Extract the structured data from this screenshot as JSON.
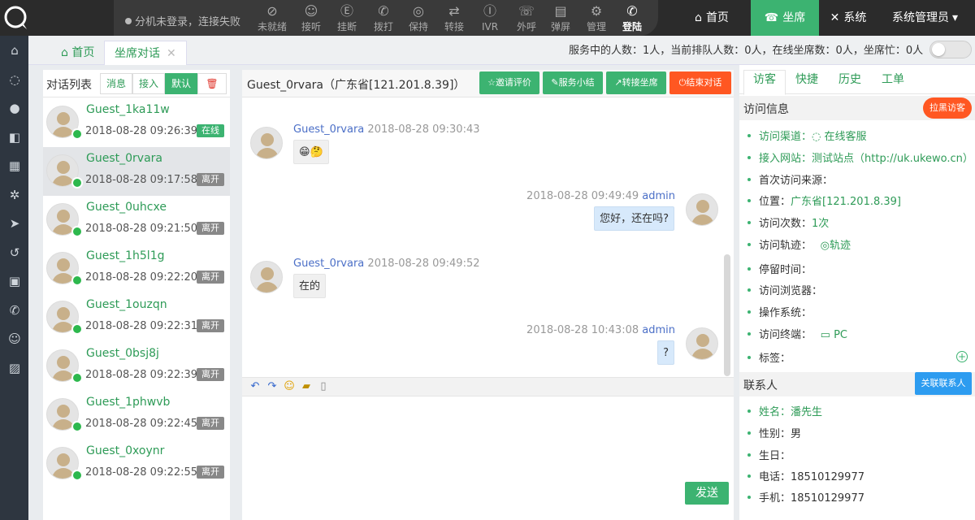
{
  "header": {
    "status_text": "分机未登录，连接失败",
    "tools": [
      {
        "label": "未就绪",
        "icon": "not-ready-icon",
        "glyph": "⊘"
      },
      {
        "label": "接听",
        "icon": "answer-icon",
        "glyph": "☺"
      },
      {
        "label": "挂断",
        "icon": "hangup-icon",
        "glyph": "Ⓔ"
      },
      {
        "label": "拨打",
        "icon": "dial-icon",
        "glyph": "✆"
      },
      {
        "label": "保持",
        "icon": "hold-icon",
        "glyph": "◎"
      },
      {
        "label": "转接",
        "icon": "transfer-icon",
        "glyph": "⇄"
      },
      {
        "label": "IVR",
        "icon": "ivr-icon",
        "glyph": "Ⓘ"
      },
      {
        "label": "外呼",
        "icon": "outbound-icon",
        "glyph": "☏"
      },
      {
        "label": "弹屏",
        "icon": "popup-icon",
        "glyph": "▤"
      },
      {
        "label": "管理",
        "icon": "manage-icon",
        "glyph": "⚙"
      },
      {
        "label": "登陆",
        "icon": "login-icon",
        "glyph": "✆"
      }
    ],
    "nav": [
      {
        "label": "首页",
        "icon": "home-icon",
        "glyph": "⌂"
      },
      {
        "label": "坐席",
        "icon": "seat-icon",
        "glyph": "☎"
      },
      {
        "label": "系统",
        "icon": "tools-icon",
        "glyph": "✕"
      },
      {
        "label": "系统管理员",
        "icon": "user-icon",
        "glyph": "▾"
      }
    ]
  },
  "sidebar": {
    "icons": [
      {
        "name": "home-icon",
        "glyph": "⌂"
      },
      {
        "name": "chat-icon",
        "glyph": "◌"
      },
      {
        "name": "user-icon",
        "glyph": "●"
      },
      {
        "name": "contact-icon",
        "glyph": "◧"
      },
      {
        "name": "apps-icon",
        "glyph": "▦"
      },
      {
        "name": "gear-icon",
        "glyph": "✲"
      },
      {
        "name": "send-icon",
        "glyph": "➤"
      },
      {
        "name": "history-icon",
        "glyph": "↺"
      },
      {
        "name": "document-icon",
        "glyph": "▣"
      },
      {
        "name": "phone-icon",
        "glyph": "✆"
      },
      {
        "name": "service-icon",
        "glyph": "☺"
      },
      {
        "name": "report-icon",
        "glyph": "▨"
      }
    ]
  },
  "crumbs": {
    "home": "首页",
    "current": "坐席对话",
    "close": "✕"
  },
  "stats": "服务中的人数：1人，当前排队人数：0人，在线坐席数：0人，坐席忙：0人",
  "conv_list": {
    "title": "对话列表",
    "buttons": [
      "消息",
      "接入",
      "默认",
      "🗑"
    ],
    "items": [
      {
        "name": "Guest_1ka11w",
        "time": "2018-08-28 09:26:39",
        "status": "在线",
        "online": true
      },
      {
        "name": "Guest_0rvara",
        "time": "2018-08-28 09:17:58",
        "status": "离开",
        "online": false
      },
      {
        "name": "Guest_0uhcxe",
        "time": "2018-08-28 09:21:50",
        "status": "离开",
        "online": false
      },
      {
        "name": "Guest_1h5l1g",
        "time": "2018-08-28 09:22:20",
        "status": "离开",
        "online": false
      },
      {
        "name": "Guest_1ouzqn",
        "time": "2018-08-28 09:22:31",
        "status": "离开",
        "online": false
      },
      {
        "name": "Guest_0bsj8j",
        "time": "2018-08-28 09:22:39",
        "status": "离开",
        "online": false
      },
      {
        "name": "Guest_1phwvb",
        "time": "2018-08-28 09:22:45",
        "status": "离开",
        "online": false
      },
      {
        "name": "Guest_0xoynr",
        "time": "2018-08-28 09:22:55",
        "status": "离开",
        "online": false
      }
    ]
  },
  "chat": {
    "title": "Guest_0rvara（广东省[121.201.8.39]）",
    "actions": [
      {
        "label": "邀请评价",
        "glyph": "☆"
      },
      {
        "label": "服务小结",
        "glyph": "✎"
      },
      {
        "label": "转接坐席",
        "glyph": "↗"
      },
      {
        "label": "结束对话",
        "glyph": "⏻"
      }
    ],
    "messages": [
      {
        "dir": "in",
        "user": "Guest_0rvara",
        "time": "2018-08-28 09:30:43",
        "text": "😁🤔"
      },
      {
        "dir": "out",
        "user": "admin",
        "time": "2018-08-28 09:49:49",
        "text": "您好，还在吗?"
      },
      {
        "dir": "in",
        "user": "Guest_0rvara",
        "time": "2018-08-28 09:49:52",
        "text": "在的"
      },
      {
        "dir": "out",
        "user": "admin",
        "time": "2018-08-28 10:43:08",
        "text": "?"
      }
    ],
    "input_tools": [
      {
        "name": "undo-icon",
        "glyph": "↶",
        "color": "#3366cc"
      },
      {
        "name": "redo-icon",
        "glyph": "↷",
        "color": "#3366cc"
      },
      {
        "name": "emoji-icon",
        "glyph": "☺",
        "color": "#e0a000"
      },
      {
        "name": "image-icon",
        "glyph": "▰",
        "color": "#c09000"
      },
      {
        "name": "attach-icon",
        "glyph": "▯",
        "color": "#888888"
      }
    ],
    "send_label": "发送"
  },
  "right": {
    "tabs": [
      "访客",
      "快捷",
      "历史",
      "工单"
    ],
    "visit_info_title": "访问信息",
    "blacklist_label": "拉黑访客",
    "info": [
      {
        "label": "访问渠道：",
        "value": "◌ 在线客服",
        "green": true
      },
      {
        "label": "接入网站：",
        "value": "测试站点（http://uk.ukewo.cn）",
        "green": true
      },
      {
        "label": "首次访问来源：",
        "value": "",
        "green": false
      },
      {
        "label": "位置：",
        "value": "广东省[121.201.8.39]",
        "green": false
      },
      {
        "label": "访问次数：",
        "value": "1次",
        "green": false
      },
      {
        "label": "访问轨迹：",
        "value": "　 ◎轨迹",
        "green": false
      },
      {
        "label": "停留时间：",
        "value": "",
        "green": false
      },
      {
        "label": "访问浏览器：",
        "value": "",
        "green": false
      },
      {
        "label": "操作系统：",
        "value": "",
        "green": false
      },
      {
        "label": "访问终端：",
        "value": "　 ▭ PC",
        "green": false
      },
      {
        "label": "标签：",
        "value": "",
        "green": false
      }
    ],
    "contacts_title": "联系人",
    "link_contact_label": "关联联系人",
    "contact": [
      {
        "label": "姓名：",
        "value": "潘先生",
        "green": true
      },
      {
        "label": "性别：",
        "value": "男",
        "green": false
      },
      {
        "label": "生日：",
        "value": "",
        "green": false
      },
      {
        "label": "电话：",
        "value": "18510129977",
        "green": false
      },
      {
        "label": "手机：",
        "value": "18510129977",
        "green": false
      }
    ],
    "plus": "+"
  }
}
